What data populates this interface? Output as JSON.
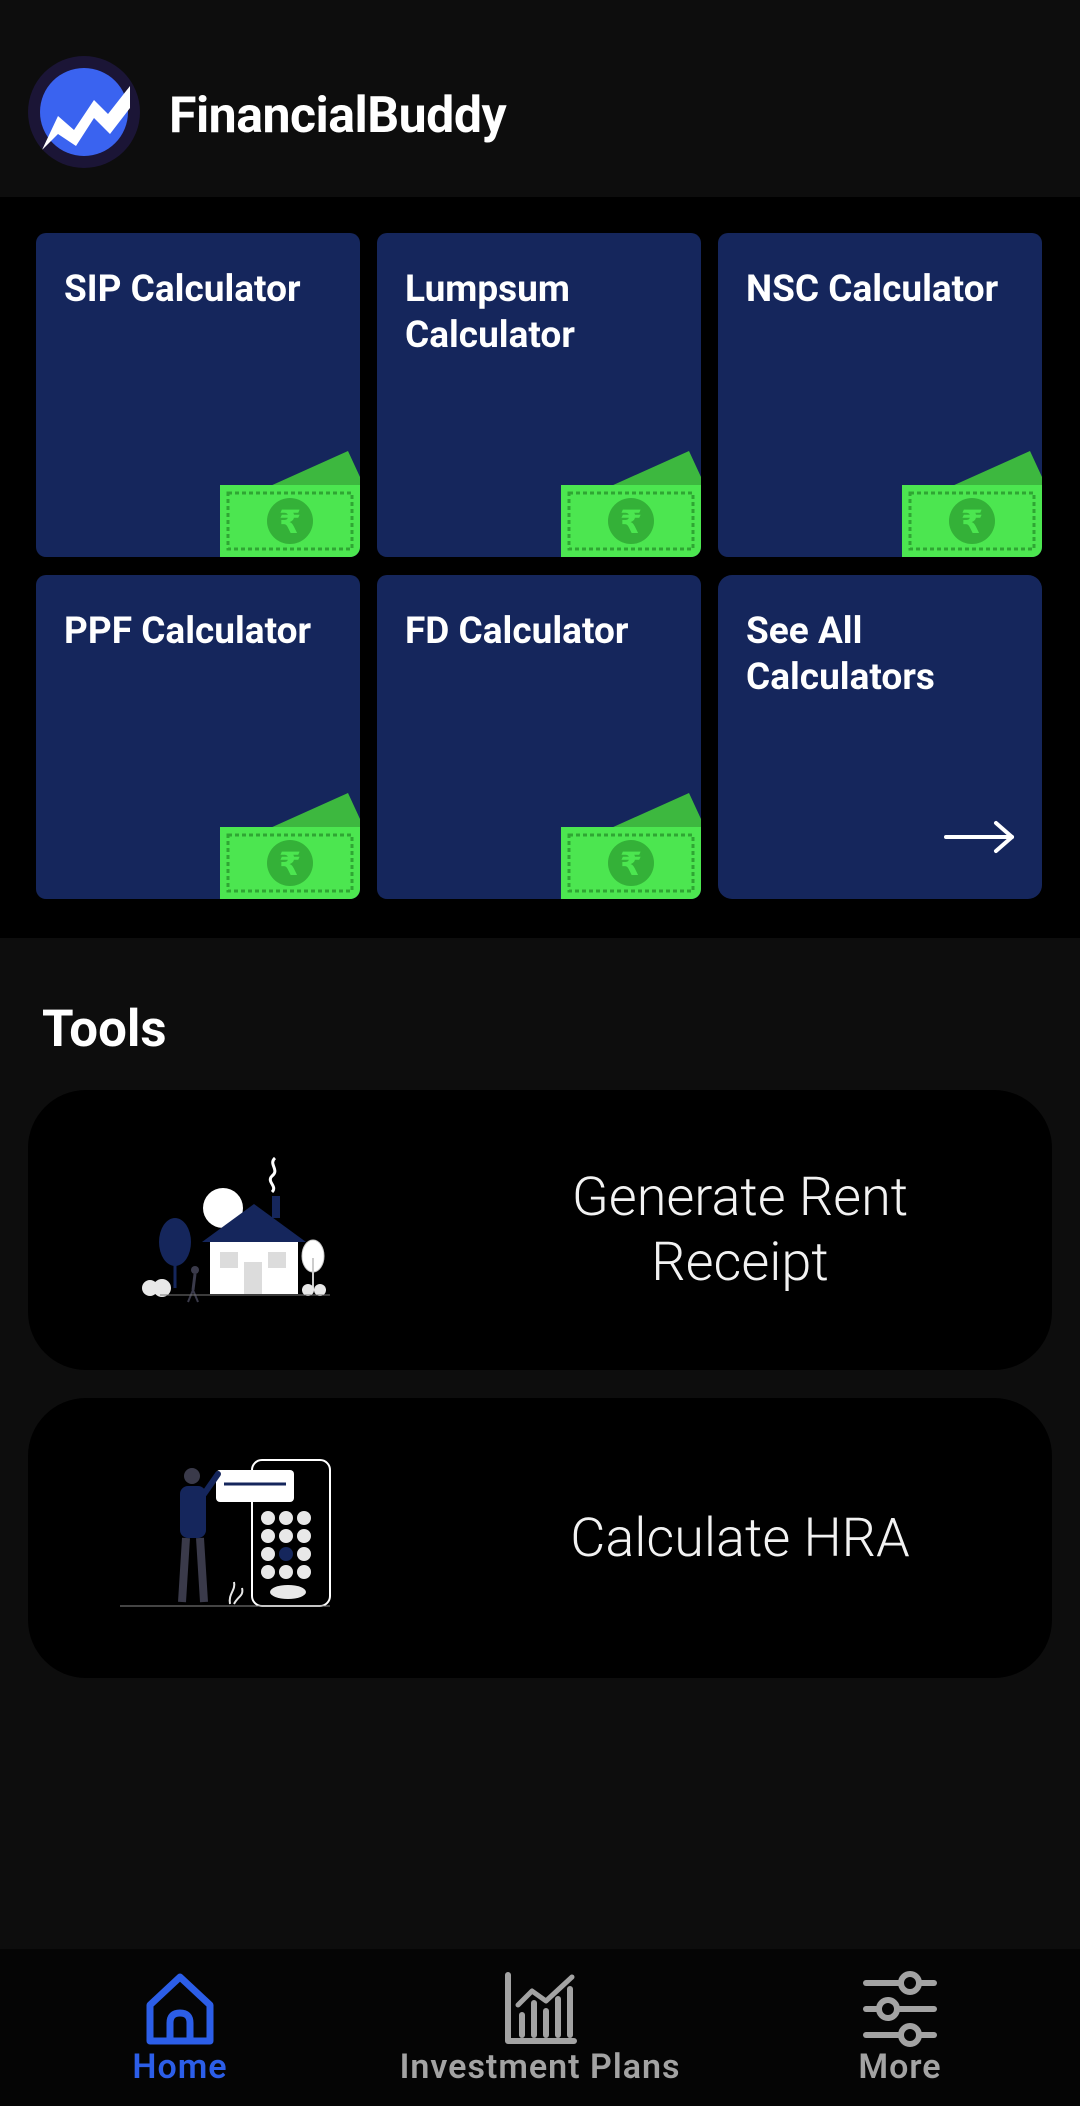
{
  "app": {
    "title": "FinancialBuddy"
  },
  "calculators": [
    {
      "label": "SIP Calculator",
      "icon": "money-icon"
    },
    {
      "label": "Lumpsum Calculator",
      "icon": "money-icon"
    },
    {
      "label": "NSC Calculator",
      "icon": "money-icon"
    },
    {
      "label": "PPF Calculator",
      "icon": "money-icon"
    },
    {
      "label": "FD Calculator",
      "icon": "money-icon"
    },
    {
      "label": "See All Calculators",
      "icon": "arrow-right-icon"
    }
  ],
  "tools": {
    "title": "Tools",
    "items": [
      {
        "label": "Generate Rent Receipt",
        "icon": "house-illustration"
      },
      {
        "label": "Calculate HRA",
        "icon": "calculator-illustration"
      }
    ]
  },
  "nav": {
    "items": [
      {
        "label": "Home",
        "icon": "home-icon",
        "active": true
      },
      {
        "label": "Investment Plans",
        "icon": "chart-icon",
        "active": false
      },
      {
        "label": "More",
        "icon": "sliders-icon",
        "active": false
      }
    ]
  },
  "colors": {
    "background": "#0d0d0d",
    "card": "#15265c",
    "money_green": "#4ce650",
    "active_tab": "#2c5ee8",
    "inactive_tab": "#a3a3a3"
  }
}
